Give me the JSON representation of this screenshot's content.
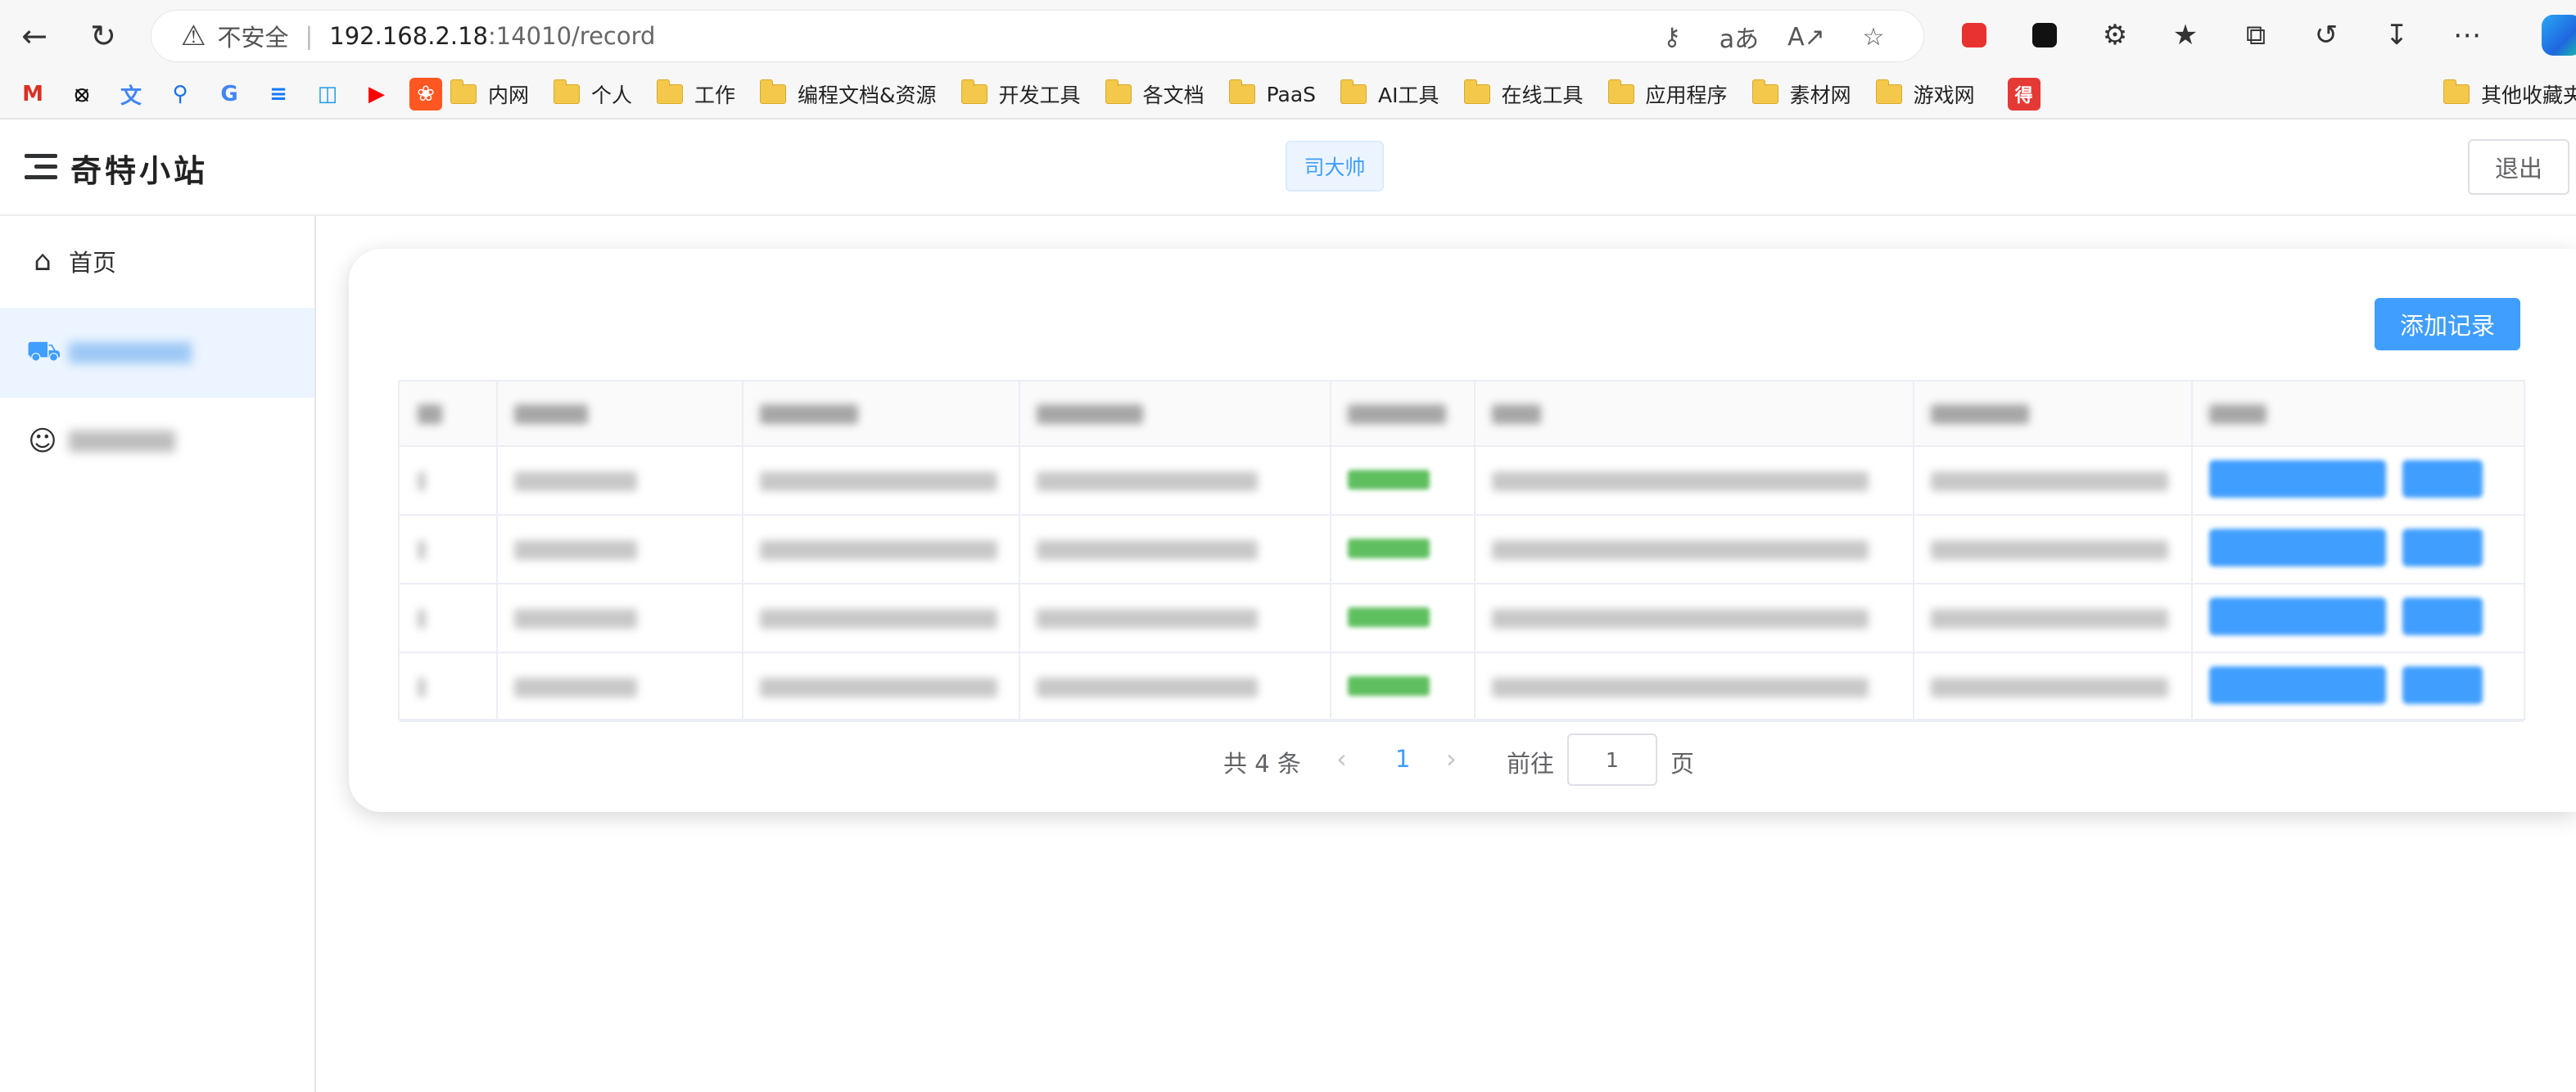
{
  "browser": {
    "security_label": "不安全",
    "url_host": "192.168.2.18",
    "url_port_path": ":14010/record",
    "bookmarks": [
      {
        "label": "内网"
      },
      {
        "label": "个人"
      },
      {
        "label": "工作"
      },
      {
        "label": "编程文档&资源"
      },
      {
        "label": "开发工具"
      },
      {
        "label": "各文档"
      },
      {
        "label": "PaaS"
      },
      {
        "label": "AI工具"
      },
      {
        "label": "在线工具"
      },
      {
        "label": "应用程序"
      },
      {
        "label": "素材网"
      },
      {
        "label": "游戏网"
      }
    ],
    "other_bookmarks": "其他收藏夹"
  },
  "header": {
    "title": "奇特小站",
    "user_name": "司大帅",
    "logout_label": "退出"
  },
  "sidebar": {
    "items": [
      {
        "label": "首页",
        "icon": "home-icon"
      },
      {
        "label": "",
        "icon": "truck-icon",
        "active": true
      },
      {
        "label": "",
        "icon": "user-icon"
      }
    ]
  },
  "main": {
    "add_button_label": "添加记录",
    "table": {
      "row_count": 4,
      "content_obscured": true
    },
    "pagination": {
      "total_text": "共 4 条",
      "current_page": "1",
      "goto_label": "前往",
      "goto_value": "1",
      "page_suffix": "页"
    }
  },
  "colors": {
    "primary": "#409eff",
    "active_bg": "#ecf5ff",
    "status_green": "#5fbf5f"
  }
}
